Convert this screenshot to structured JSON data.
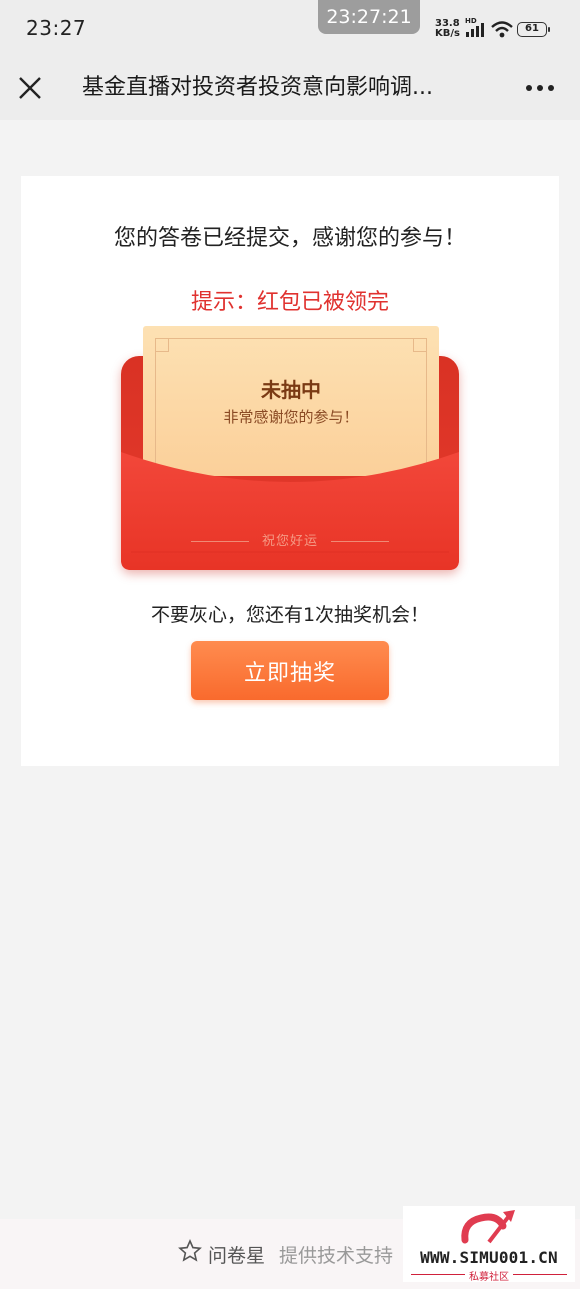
{
  "status_bar": {
    "time": "23:27",
    "overlay_time": "23:27:21",
    "net_speed_value": "33.8",
    "net_speed_unit": "KB/s",
    "hd_label": "HD",
    "battery": "61"
  },
  "title_bar": {
    "title": "基金直播对投资者投资意向影响调..."
  },
  "card": {
    "submit_message": "您的答卷已经提交，感谢您的参与！",
    "tip_message": "提示：红包已被领完",
    "letter_title": "未抽中",
    "letter_subtitle": "非常感谢您的参与！",
    "envelope_slogan": "祝您好运",
    "encourage_text": "不要灰心，您还有1次抽奖机会！",
    "draw_button_label": "立即抽奖"
  },
  "footer": {
    "brand": "问卷星",
    "support_text": "提供技术支持"
  },
  "watermark": {
    "domain": "WWW.SIMU001.CN",
    "subtitle": "私募社区"
  },
  "colors": {
    "accent_red": "#e0322f",
    "button_orange": "#f96a2d",
    "envelope_red": "#e63a2d"
  }
}
